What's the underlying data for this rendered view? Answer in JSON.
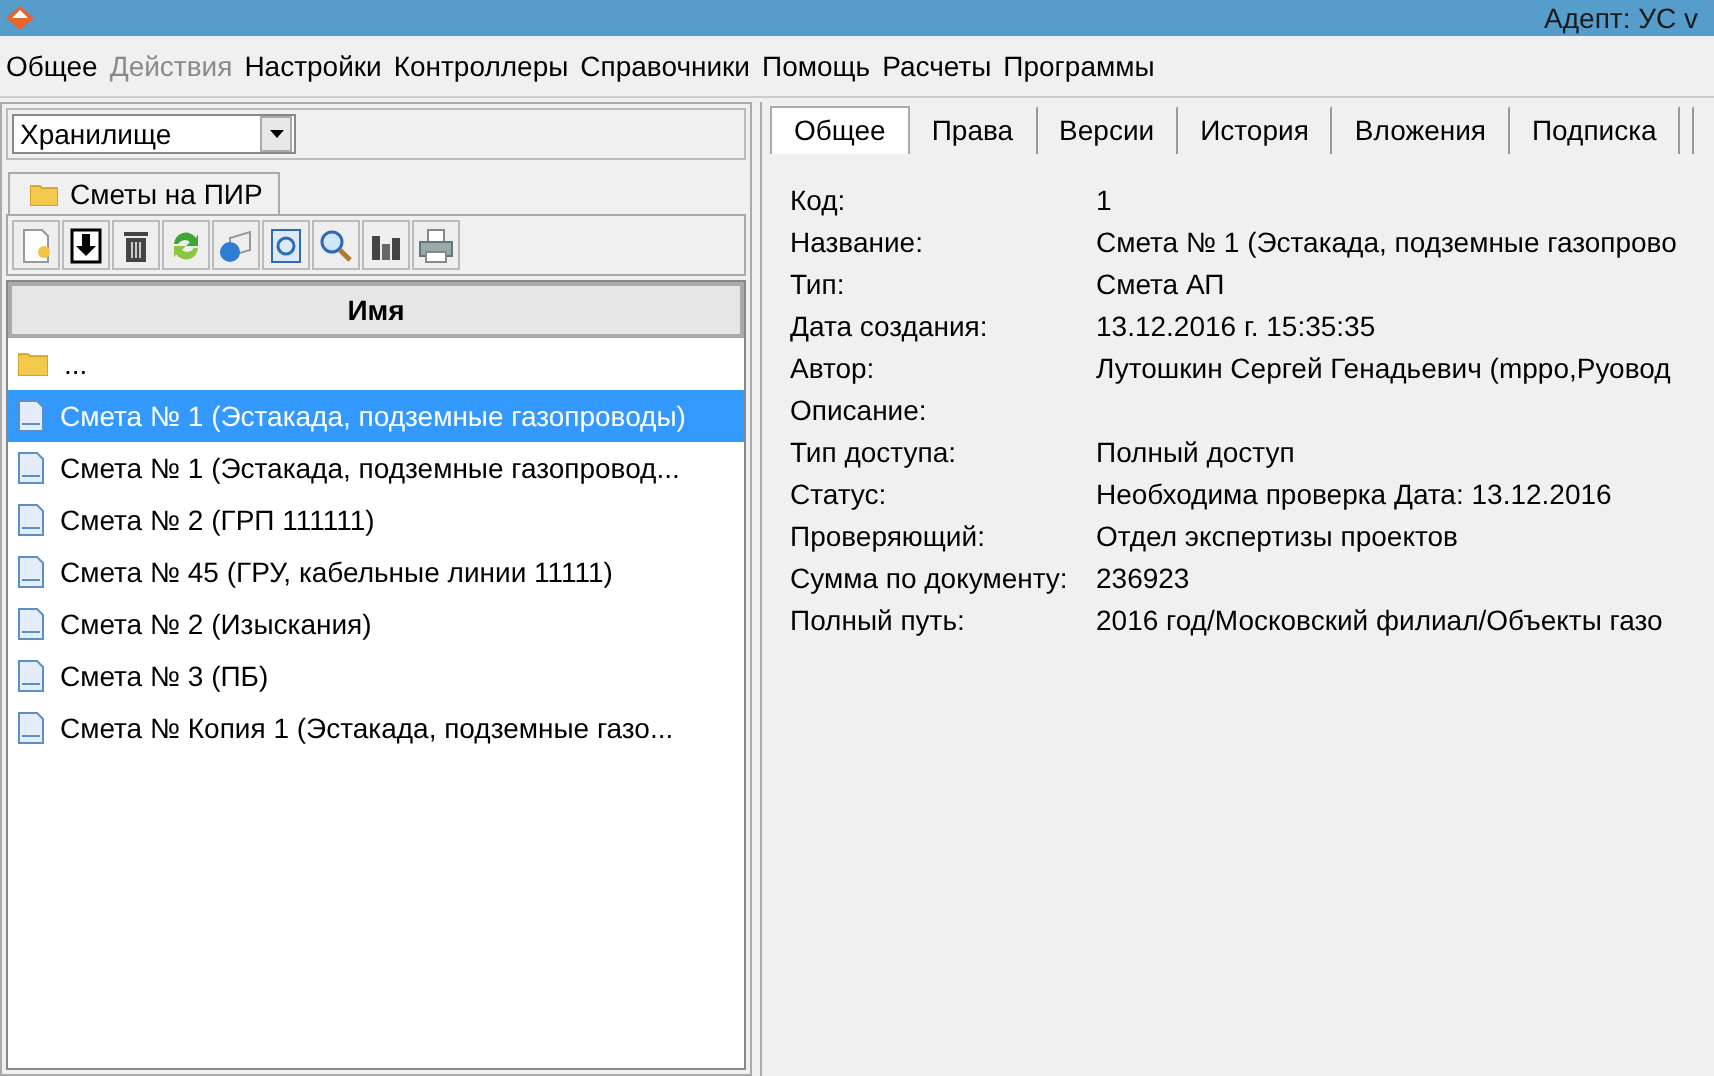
{
  "window": {
    "title": "Адепт: УС  v"
  },
  "menu": [
    {
      "label": "Общее",
      "disabled": false
    },
    {
      "label": "Действия",
      "disabled": true
    },
    {
      "label": "Настройки",
      "disabled": false
    },
    {
      "label": "Контроллеры",
      "disabled": false
    },
    {
      "label": "Справочники",
      "disabled": false
    },
    {
      "label": "Помощь",
      "disabled": false
    },
    {
      "label": "Расчеты",
      "disabled": false
    },
    {
      "label": "Программы",
      "disabled": false
    }
  ],
  "left_panel": {
    "storage_select": {
      "value": "Хранилище"
    },
    "folder_tab": {
      "label": "Сметы на ПИР"
    },
    "toolbar": [
      {
        "kind": "new"
      },
      {
        "kind": "download"
      },
      {
        "kind": "delete"
      },
      {
        "kind": "refresh"
      },
      {
        "kind": "send"
      },
      {
        "kind": "preview"
      },
      {
        "kind": "search"
      },
      {
        "kind": "chart"
      },
      {
        "kind": "print"
      }
    ],
    "list": {
      "column": "Имя",
      "rows": [
        {
          "kind": "folder",
          "name": "...",
          "selected": false
        },
        {
          "kind": "document",
          "name": "Смета № 1 (Эстакада, подземные газопроводы)",
          "selected": true
        },
        {
          "kind": "document",
          "name": "Смета № 1 (Эстакада, подземные газопровод...",
          "selected": false
        },
        {
          "kind": "document",
          "name": "Смета № 2 (ГРП 111111)",
          "selected": false
        },
        {
          "kind": "document",
          "name": "Смета № 45 (ГРУ, кабельные линии 11111)",
          "selected": false
        },
        {
          "kind": "document",
          "name": "Смета № 2 (Изыскания)",
          "selected": false
        },
        {
          "kind": "document",
          "name": "Смета № 3 (ПБ)",
          "selected": false
        },
        {
          "kind": "document",
          "name": "Смета № Копия 1 (Эстакада, подземные газо...",
          "selected": false
        }
      ]
    }
  },
  "details": {
    "tabs": [
      {
        "label": "Общее",
        "selected": true
      },
      {
        "label": "Права",
        "selected": false
      },
      {
        "label": "Версии",
        "selected": false
      },
      {
        "label": "История",
        "selected": false
      },
      {
        "label": "Вложения",
        "selected": false
      },
      {
        "label": "Подписка",
        "selected": false
      }
    ],
    "fields": [
      {
        "label": "Код:",
        "value": "1"
      },
      {
        "label": "Название:",
        "value": "Смета № 1 (Эстакада, подземные газопрово"
      },
      {
        "label": "Тип:",
        "value": "Смета АП"
      },
      {
        "label": "Дата создания:",
        "value": "13.12.2016 г. 15:35:35"
      },
      {
        "label": "Автор:",
        "value": "Лутошкин Сергей Генадьевич (mppo,Руовод"
      },
      {
        "label": "Описание:"
      },
      {
        "label": "Тип доступа:",
        "value": "Полный доступ"
      },
      {
        "label": "Статус:",
        "value": "Необходима проверка Дата: 13.12.2016"
      },
      {
        "label": "Проверяющий:",
        "value": "Отдел экспертизы проектов"
      },
      {
        "label": "Сумма по документу:",
        "value": "236923"
      },
      {
        "label": "Полный путь:",
        "value": "2016 год/Московский филиал/Объекты газо"
      }
    ]
  }
}
